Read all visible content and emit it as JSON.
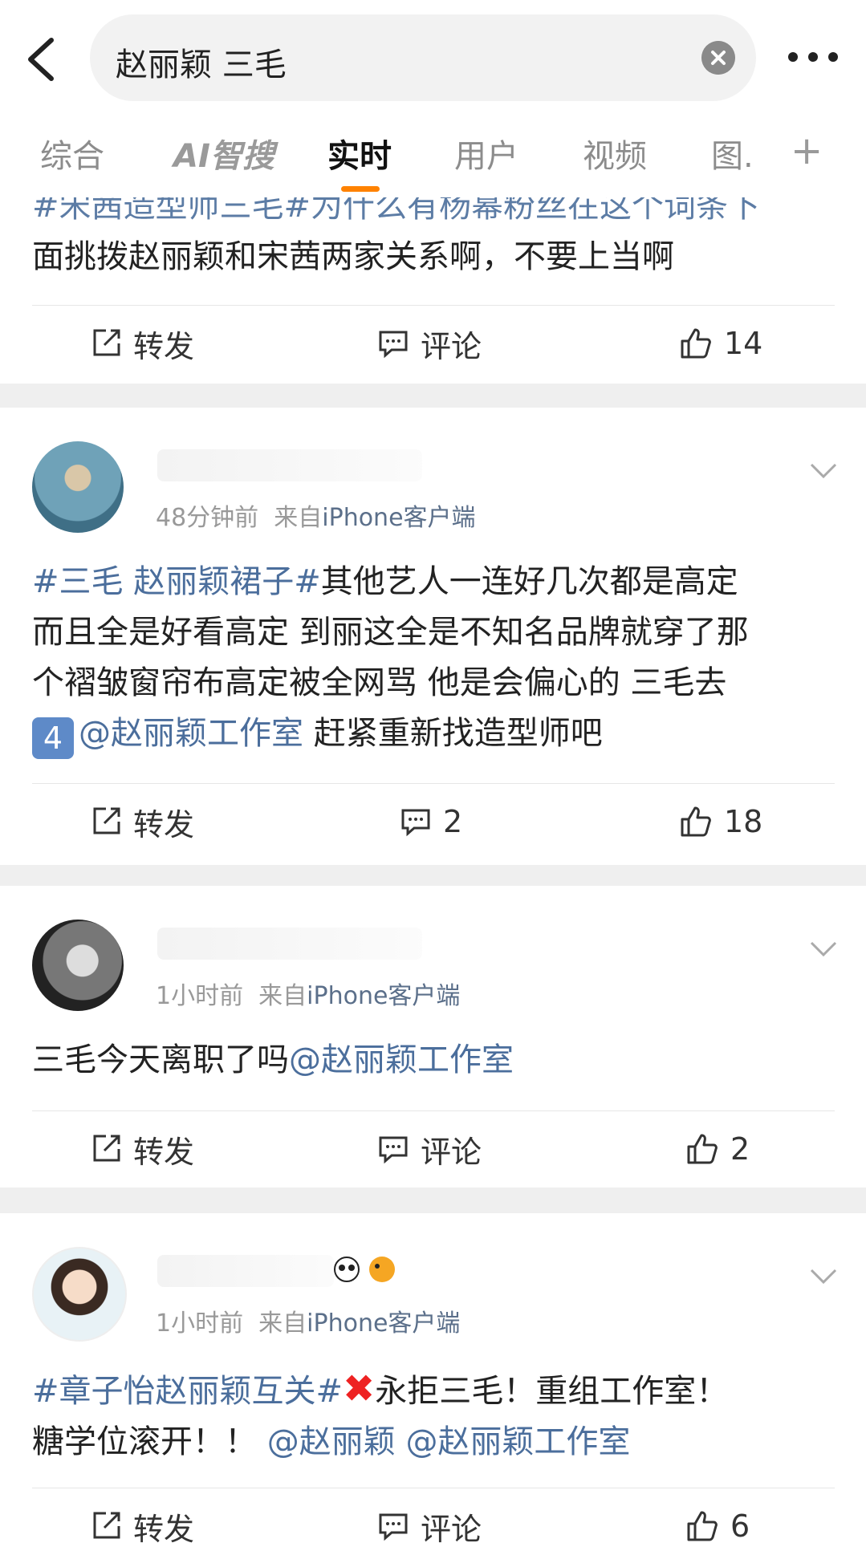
{
  "search": {
    "query": "赵丽颖 三毛"
  },
  "tabs": [
    "综合",
    "AI智搜",
    "实时",
    "用户",
    "视频",
    "图."
  ],
  "tab_more": "+",
  "accent_color": "#ff8200",
  "link_color": "#4b6e9c",
  "actions": {
    "repost": "转发",
    "comment": "评论"
  },
  "posts": [
    {
      "partial": true,
      "text_top": "#宋茜造型师三毛#为什么有杨幂粉丝在这个词条下",
      "text": "面挑拨赵丽颖和宋茜两家关系啊，不要上当啊",
      "likes": "14"
    },
    {
      "time": "48分钟前",
      "source_prefix": "来自",
      "source": "iPhone客户端",
      "tag": "#三毛 赵丽颖裙子#",
      "text1": "其他艺人一连好几次都是高定",
      "text2": "而且全是好看高定 到丽这全是不知名品牌就穿了那",
      "text3": "个褶皱窗帘布高定被全网骂 他是会偏心的 三毛去",
      "badge": "4",
      "mention": "@赵丽颖工作室",
      "text4": " 赶紧重新找造型师吧",
      "comments": "2",
      "likes": "18"
    },
    {
      "time": "1小时前",
      "source_prefix": "来自",
      "source": "iPhone客户端",
      "text": "三毛今天离职了吗",
      "mention": "@赵丽颖工作室",
      "likes": "2"
    },
    {
      "time": "1小时前",
      "source_prefix": "来自",
      "source": "iPhone客户端",
      "tag": "#章子怡赵丽颖互关#",
      "cross": "✖",
      "text1": "永拒三毛！重组工作室！",
      "text2": "糖学位滚开！！",
      "mention1": "@赵丽颖",
      "mention2": "@赵丽颖工作室",
      "likes": "6"
    }
  ]
}
